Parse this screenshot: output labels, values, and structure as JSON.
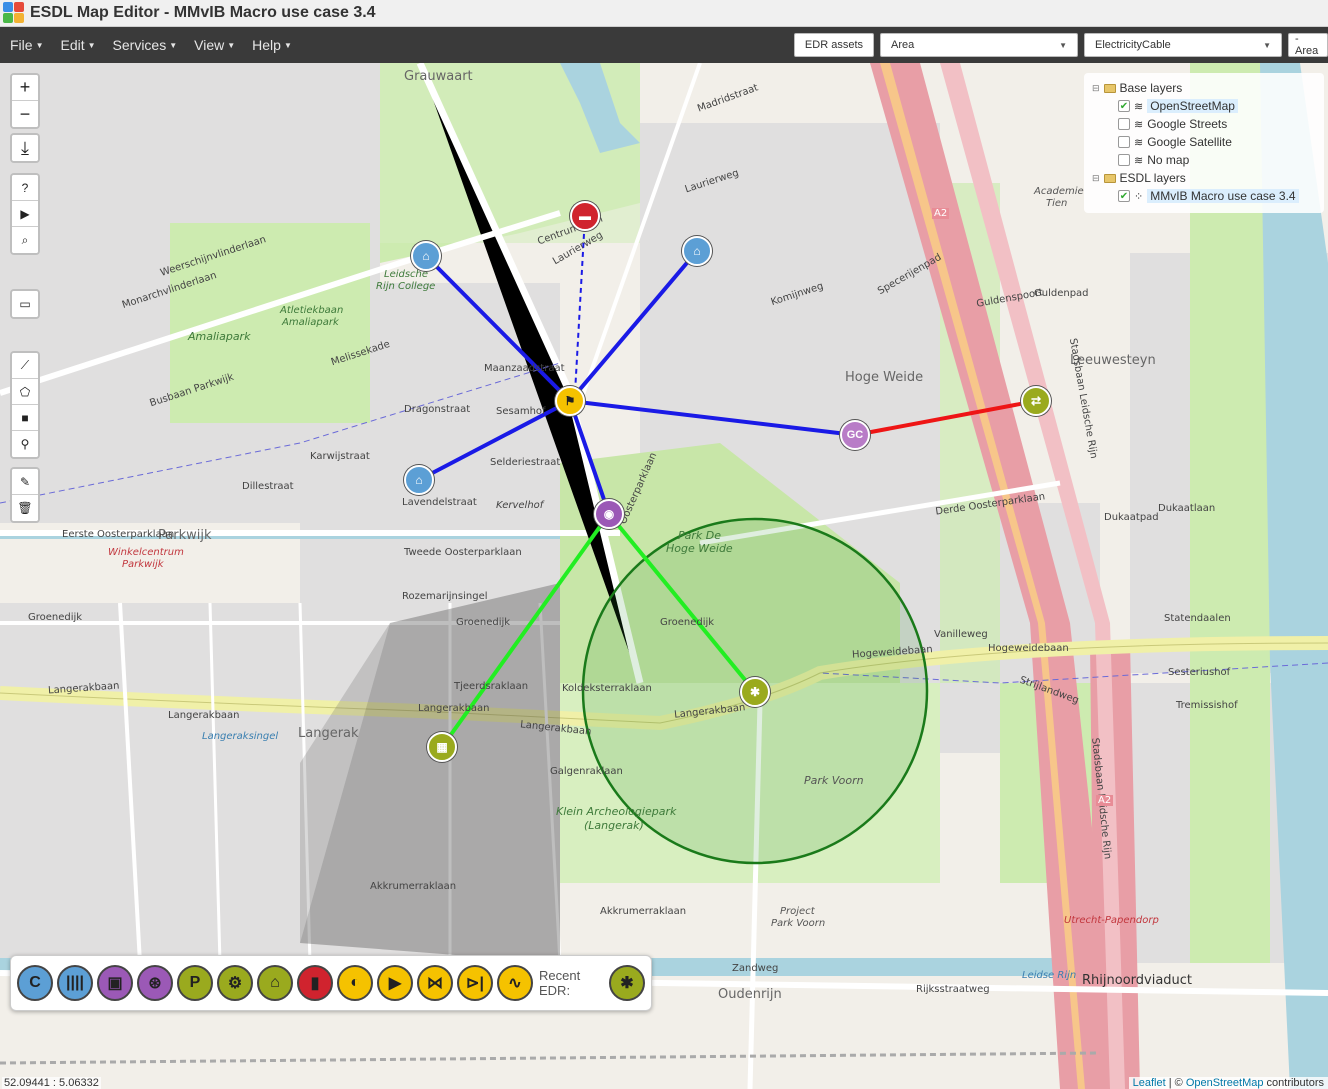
{
  "window": {
    "title": "ESDL Map Editor - MMvIB Macro use case 3.4"
  },
  "menu": {
    "items": [
      {
        "label": "File"
      },
      {
        "label": "Edit"
      },
      {
        "label": "Services"
      },
      {
        "label": "View"
      },
      {
        "label": "Help"
      }
    ],
    "edr_button": "EDR assets",
    "area_select": "Area",
    "cable_select": "ElectricityCable",
    "area_select_2": "- Area"
  },
  "layers": {
    "base_group": "Base layers",
    "base_items": [
      {
        "label": "OpenStreetMap",
        "checked": true
      },
      {
        "label": "Google Streets",
        "checked": false
      },
      {
        "label": "Google Satellite",
        "checked": false
      },
      {
        "label": "No map",
        "checked": false
      }
    ],
    "esdl_group": "ESDL layers",
    "esdl_items": [
      {
        "label": "MMvIB Macro use case 3.4",
        "checked": true
      }
    ]
  },
  "map_controls": {
    "zoom_in": "+",
    "zoom_out": "−",
    "download": "⤓",
    "help": "?",
    "play": "▶",
    "search": "⌕",
    "comment": "▭",
    "line": "⟋",
    "polygon": "⬠",
    "rectangle": "■",
    "marker": "⚲",
    "edit": "✎",
    "delete": "🗑"
  },
  "assets": {
    "gas_conversion_label": "GC"
  },
  "map_labels": {
    "grauwaart": "Grauwaart",
    "amaliapark": "Amaliapark",
    "atletiekbaan": "Atletiekbaan",
    "atletiekbaan2": "Amaliapark",
    "leidsche": "Leidsche",
    "rijn_college": "Rijn College",
    "hoge_weide": "Hoge Weide",
    "leeuwesteyn": "Leeuwesteyn",
    "parkwijk": "Parkwijk",
    "winkelcentrum": "Winkelcentrum",
    "winkelcentrum2": "Parkwijk",
    "park_de": "Park De",
    "hoge_weide_park": "Hoge Weide",
    "langerak": "Langerak",
    "park_voorn": "Park Voorn",
    "klein_arch": "Klein Archeologiepark",
    "klein_arch2": "(Langerak)",
    "oudenrijn": "Oudenrijn",
    "rhijnoord": "Rhijnoordviaduct",
    "utrecht_pap": "Utrecht-Papendorp",
    "project": "Project",
    "project2": "Park Voorn",
    "academie": "Academie",
    "academie2": "Tien",
    "eerste": "Eerste Oosterparklaan",
    "tweede": "Tweede Oosterparklaan",
    "derde": "Derde Oosterparklaan",
    "langerakbaan": "Langerakbaan",
    "hogeweidebaan": "Hogeweidebaan",
    "zandweg": "Zandweg",
    "rijksstraatweg": "Rijksstraatweg",
    "leidse_rijn": "Leidse Rijn",
    "groenedijk": "Groenedijk",
    "dillestraat": "Dillestraat",
    "dragonstraat": "Dragonstraat",
    "karwijstraat": "Karwijstraat",
    "maanzaadstraat": "Maanzaadstraat",
    "lavendelstraat": "Lavendelstraat",
    "kervelhof": "Kervelhof",
    "selderiestraat": "Selderiestraat",
    "sesamhof": "Sesamhof",
    "melissekade": "Melissekade",
    "busbaan": "Busbaan Parkwijk",
    "rozemarijnsingel": "Rozemarijnsingel",
    "galgenraklaan": "Galgenraklaan",
    "akkrumerraklaan": "Akkrumerraklaan",
    "stadsbaan": "Stadsbaan Leidsche Rijn",
    "a2": "A2",
    "langeraksingel": "Langeraksingel",
    "tjeerdsraklaan": "Tjeerdsraklaan",
    "koldeksterraklaan": "Koldeksterraklaan",
    "guldenspoort": "Guldenspoort",
    "guldenpad": "Guldenpad",
    "strijlandweg": "Strijlandweg",
    "vanilleweg": "Vanilleweg",
    "statendaalen": "Statendaalen",
    "sesteriushof": "Sesteriushof",
    "tremissishof": "Tremissishof",
    "dukaatpad": "Dukaatpad",
    "dukaatlaan": "Dukaatlaan",
    "laurierweg": "Laurierweg",
    "specerijenpad": "Specerijenpad",
    "komijnweg": "Komijnweg",
    "madridstraat": "Madridstraat",
    "monarchvlinderlaan": "Monarchvlinderlaan",
    "weerschijnvlinder": "Weerschijnvlinderlaan",
    "centrumbaan": "Centrumbaan",
    "laurierweg2": "Laurierweg",
    "sterrenkers": "Oosterparklaan"
  },
  "palette": {
    "buttons": [
      {
        "name": "consumer",
        "glyph": "C",
        "bg": "#5c9fd5"
      },
      {
        "name": "heatpump",
        "glyph": "||||",
        "bg": "#5c9fd5"
      },
      {
        "name": "transformer",
        "glyph": "▣",
        "bg": "#9b59b6"
      },
      {
        "name": "conversion",
        "glyph": "⊛",
        "bg": "#9b59b6"
      },
      {
        "name": "pv-parc",
        "glyph": "P",
        "bg": "#9aaa1e"
      },
      {
        "name": "windpark",
        "glyph": "⚙",
        "bg": "#9aaa1e"
      },
      {
        "name": "factory",
        "glyph": "⌂",
        "bg": "#9aaa1e"
      },
      {
        "name": "battery",
        "glyph": "▮",
        "bg": "#d0232e"
      },
      {
        "name": "pump",
        "glyph": "◐",
        "bg": "#f5c200"
      },
      {
        "name": "valve",
        "glyph": "▶",
        "bg": "#f5c200"
      },
      {
        "name": "checkvalve",
        "glyph": "⋈",
        "bg": "#f5c200"
      },
      {
        "name": "diode",
        "glyph": "⊳|",
        "bg": "#f5c200"
      },
      {
        "name": "ac-source",
        "glyph": "∿",
        "bg": "#f5c200"
      }
    ],
    "recent_label": "Recent EDR:",
    "recent_glyph": "✱",
    "recent_bg": "#9aaa1e"
  },
  "status": {
    "coords": "52.09441 : 5.06332",
    "attribution_leaflet": "Leaflet",
    "attribution_sep": " | © ",
    "attribution_osm": "OpenStreetMap",
    "attribution_rest": " contributors"
  },
  "colors": {
    "blue_line": "#1a1ae6",
    "green_line": "#22ee22",
    "red_line": "#ee1515",
    "consumer": "#5c9fd5",
    "hub": "#f5c200",
    "transformer": "#9b59b6",
    "producer": "#9aaa1e",
    "storage": "#d0232e"
  }
}
